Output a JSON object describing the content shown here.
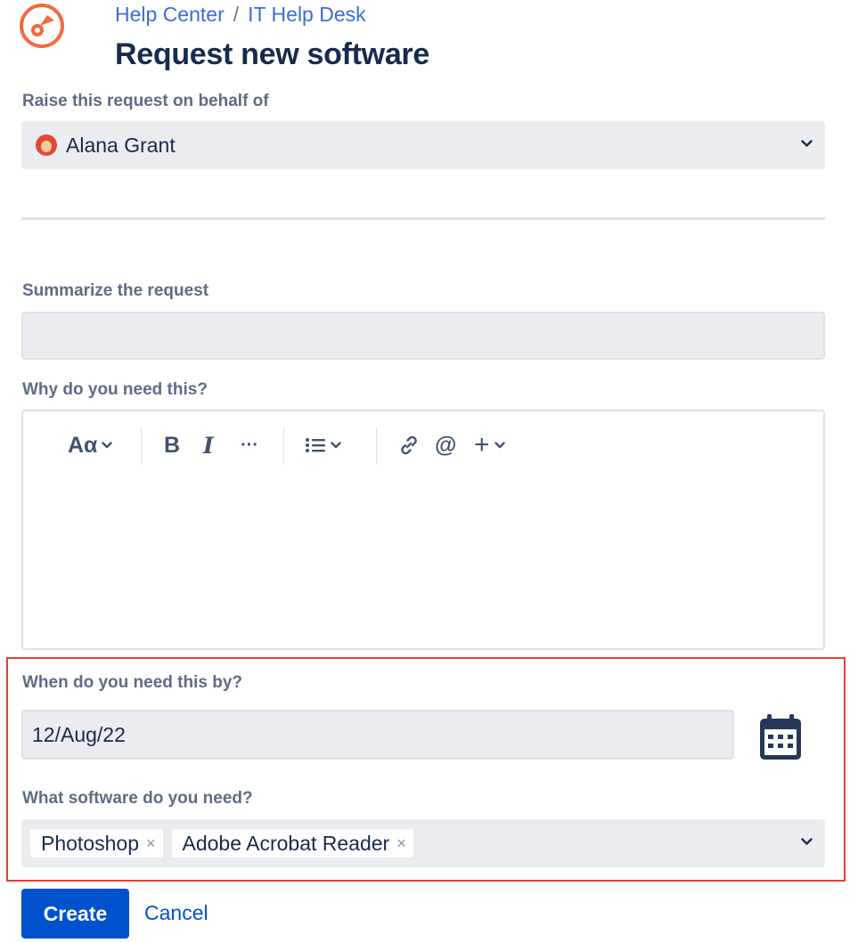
{
  "header": {
    "breadcrumb": [
      "Help Center",
      "/",
      "IT Help Desk"
    ],
    "title": "Request new software",
    "logo_icon": "help-center-logo-icon",
    "accent_color": "#f26b3a"
  },
  "form": {
    "behalf": {
      "label": "Raise this request on behalf of",
      "value": "Alana Grant",
      "icon": "user-avatar"
    },
    "summary": {
      "label": "Summarize the request",
      "value": ""
    },
    "why": {
      "label": "Why do you need this?",
      "toolbar": {
        "text_style": "Aα",
        "bold": "B",
        "italic": "I",
        "more": "···",
        "list": "☰",
        "link": "link-icon",
        "mention": "@",
        "insert": "+"
      }
    },
    "need_by": {
      "label": "When do you need this by?",
      "value": "12/Aug/22",
      "icon": "calendar-icon"
    },
    "software": {
      "label": "What software do you need?",
      "tags": [
        "Photoshop",
        "Adobe Acrobat Reader"
      ],
      "remove_glyph": "×"
    }
  },
  "actions": {
    "create": "Create",
    "cancel": "Cancel",
    "primary_color": "#0052cc"
  },
  "highlight_color": "#e2402f"
}
